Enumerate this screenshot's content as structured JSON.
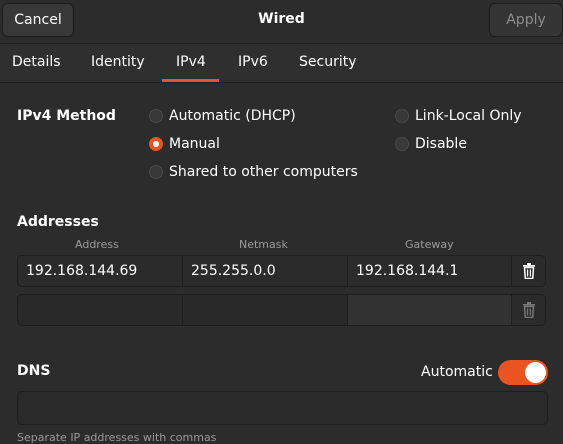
{
  "header": {
    "title": "Wired",
    "cancel_label": "Cancel",
    "apply_label": "Apply"
  },
  "tabs": [
    {
      "label": "Details"
    },
    {
      "label": "Identity"
    },
    {
      "label": "IPv4",
      "selected": true
    },
    {
      "label": "IPv6"
    },
    {
      "label": "Security"
    }
  ],
  "ipv4_method": {
    "label": "IPv4 Method",
    "options": [
      {
        "label": "Automatic (DHCP)",
        "checked": false
      },
      {
        "label": "Manual",
        "checked": true
      },
      {
        "label": "Shared to other computers",
        "checked": false
      },
      {
        "label": "Link-Local Only",
        "checked": false
      },
      {
        "label": "Disable",
        "checked": false
      }
    ]
  },
  "addresses": {
    "label": "Addresses",
    "columns": [
      "Address",
      "Netmask",
      "Gateway"
    ],
    "rows": [
      {
        "address": "192.168.144.69",
        "netmask": "255.255.0.0",
        "gateway": "192.168.144.1"
      },
      {
        "address": "",
        "netmask": "",
        "gateway": ""
      }
    ]
  },
  "dns": {
    "label": "DNS",
    "automatic_label": "Automatic",
    "automatic_on": true,
    "value": "",
    "hint": "Separate IP addresses with commas"
  },
  "colors": {
    "accent": "#e95420",
    "background": "#2c2c2c"
  },
  "icons": {
    "delete": "trash-icon"
  }
}
